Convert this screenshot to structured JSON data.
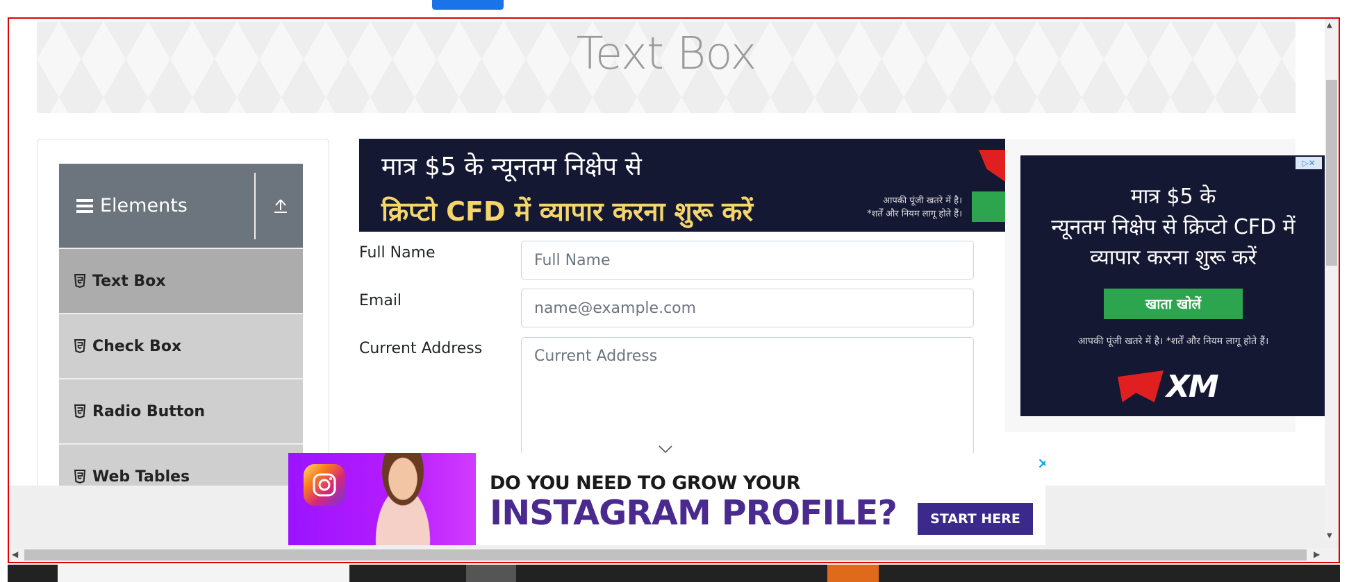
{
  "page": {
    "title": "Text Box"
  },
  "sidebar": {
    "group_title": "Elements",
    "items": [
      {
        "label": "Text Box",
        "active": true
      },
      {
        "label": "Check Box",
        "active": false
      },
      {
        "label": "Radio Button",
        "active": false
      },
      {
        "label": "Web Tables",
        "active": false
      }
    ]
  },
  "form": {
    "fullname_label": "Full Name",
    "fullname_placeholder": "Full Name",
    "email_label": "Email",
    "email_placeholder": "name@example.com",
    "address_label": "Current Address",
    "address_placeholder": "Current Address"
  },
  "ads": {
    "top_banner": {
      "line1": "मात्र $5 के न्यूनतम निक्षेप से",
      "line2": "क्रिप्टो CFD में व्यापार करना शुरू करें",
      "disclaimer1": "आपकी पूंजी खतरे में है।",
      "disclaimer2": "*शर्तें और नियम लागू होते हैं।"
    },
    "side_banner": {
      "line1": "मात्र $5 के",
      "line2": "न्यूनतम निक्षेप से क्रिप्टो CFD में",
      "line3": "व्यापार करना शुरू करें",
      "cta": "खाता खोलें",
      "disclaimer": "आपकी पूंजी खतरे में है। *शर्तें और नियम लागू होते हैं।",
      "brand": "XM"
    },
    "instagram": {
      "headline": "DO YOU NEED TO GROW YOUR",
      "headline2": "INSTAGRAM PROFILE?",
      "cta": "START HERE",
      "close": "✕"
    }
  },
  "colors": {
    "frame_border": "#e00000",
    "sidebar_header": "#6c757d",
    "active_item": "#acacac",
    "ad_background": "#151833",
    "ad_green": "#2da44e"
  }
}
